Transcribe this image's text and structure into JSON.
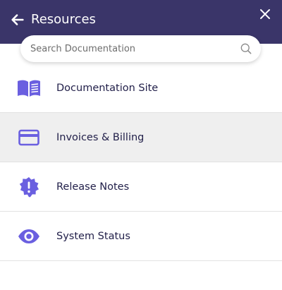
{
  "header": {
    "title": "Resources",
    "background_color": "#3a3569",
    "back_icon": "arrow-left-icon",
    "close_icon": "close-icon"
  },
  "search": {
    "placeholder": "Search Documentation",
    "value": "",
    "icon": "search-icon"
  },
  "menu": {
    "accent_color": "#6a5fe0",
    "items": [
      {
        "label": "Documentation Site",
        "icon": "open-book-icon",
        "active": false
      },
      {
        "label": "Invoices & Billing",
        "icon": "credit-card-icon",
        "active": true
      },
      {
        "label": "Release Notes",
        "icon": "alert-badge-icon",
        "active": false
      },
      {
        "label": "System Status",
        "icon": "eye-icon",
        "active": false
      }
    ]
  }
}
